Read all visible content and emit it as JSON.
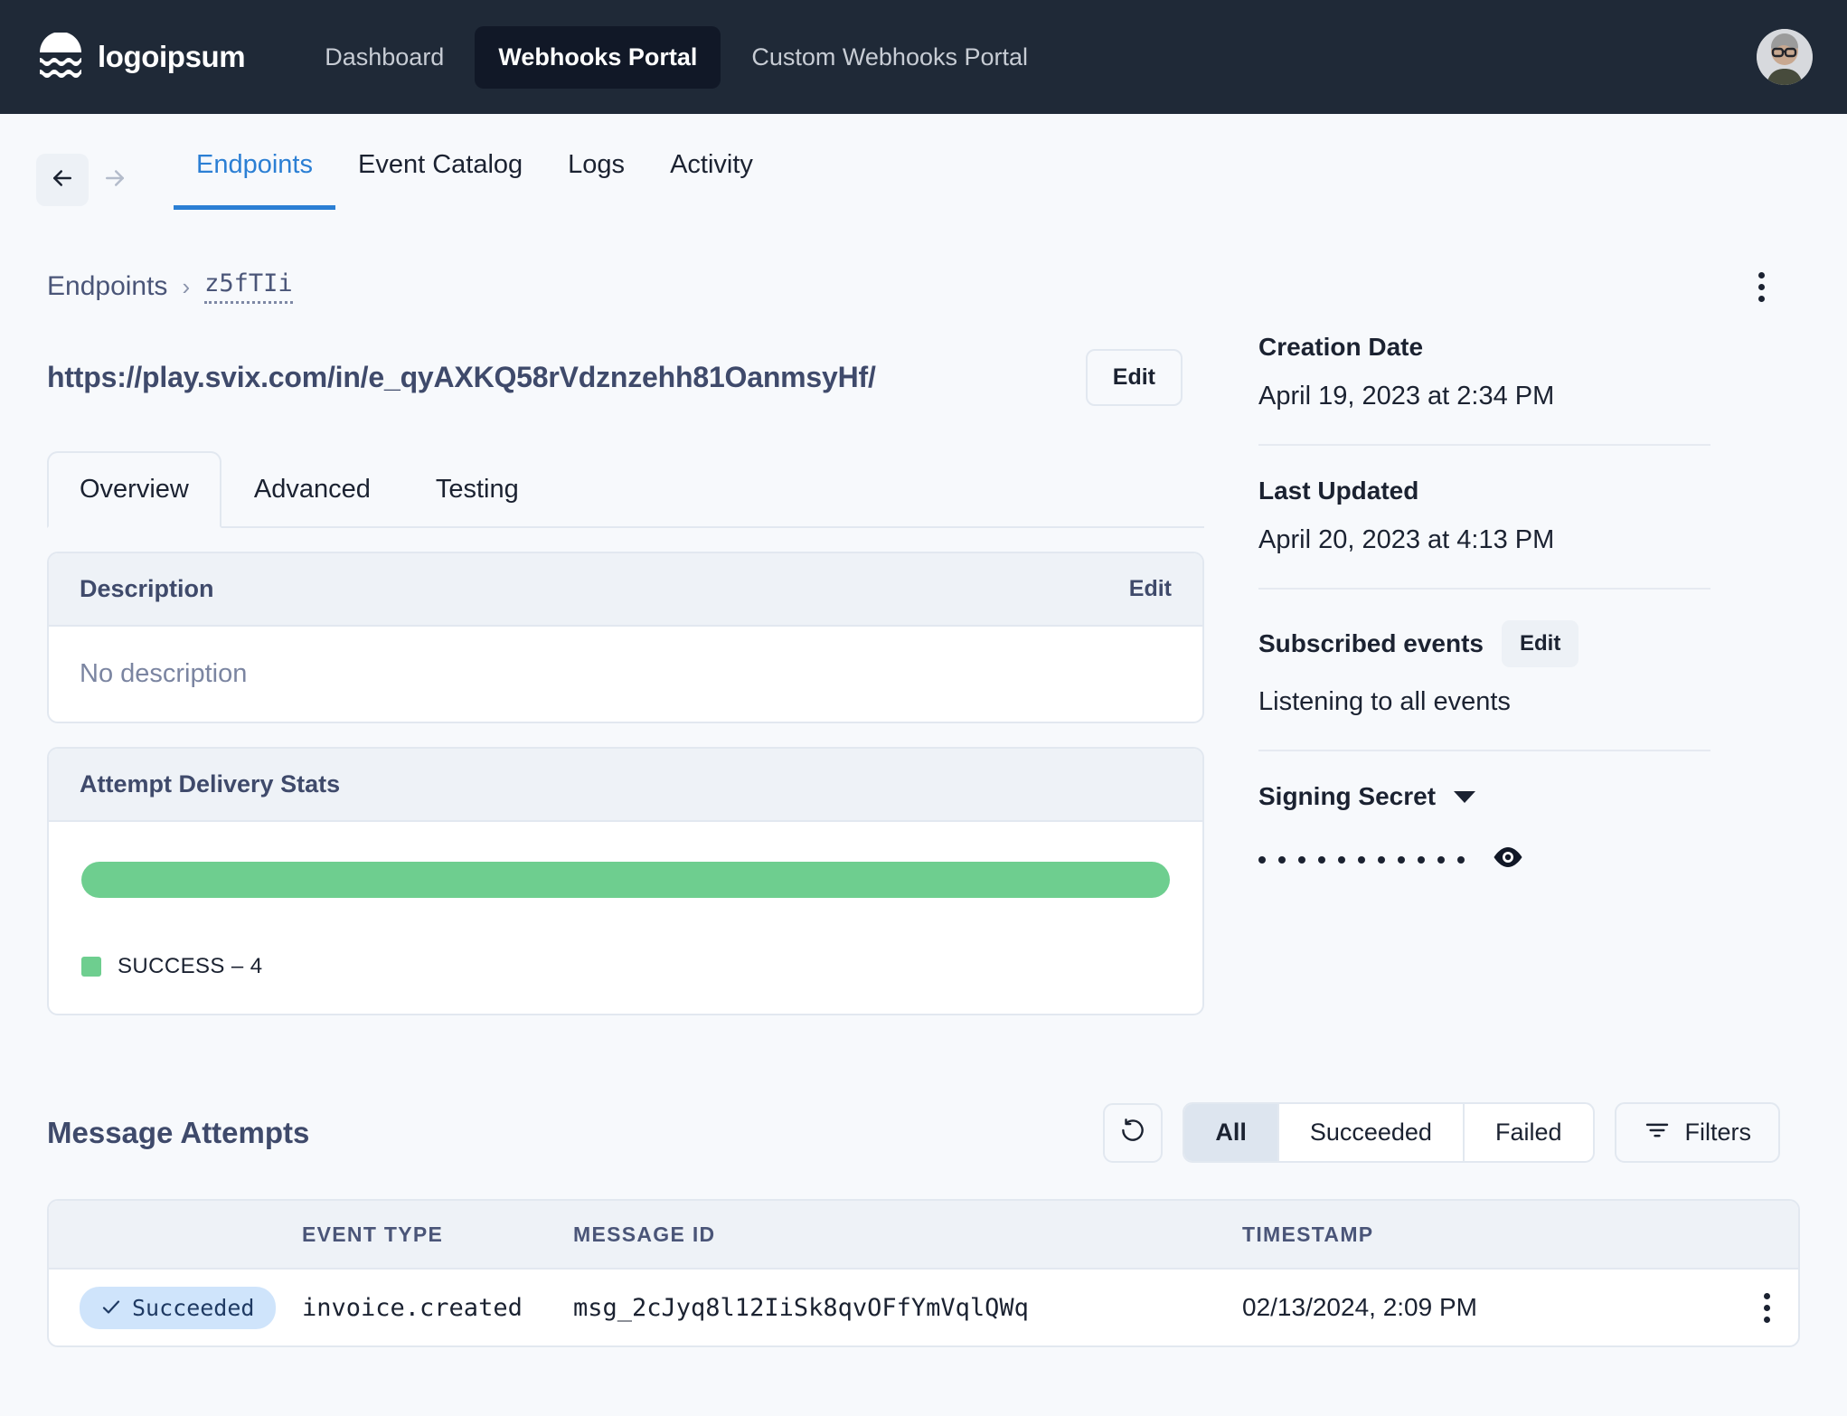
{
  "topnav": {
    "brand": "logoipsum",
    "brand_icon": "wave-logo-icon",
    "links": [
      {
        "label": "Dashboard",
        "active": false
      },
      {
        "label": "Webhooks Portal",
        "active": true
      },
      {
        "label": "Custom Webhooks Portal",
        "active": false
      }
    ],
    "avatar_name": "user-avatar"
  },
  "subnav": {
    "back_icon": "arrow-left-icon",
    "forward_icon": "arrow-right-icon",
    "tabs": [
      {
        "label": "Endpoints",
        "active": true
      },
      {
        "label": "Event Catalog",
        "active": false
      },
      {
        "label": "Logs",
        "active": false
      },
      {
        "label": "Activity",
        "active": false
      }
    ]
  },
  "breadcrumb": {
    "root": "Endpoints",
    "separator": "›",
    "current": "z5fTIi",
    "kebab_icon": "more-vertical-icon"
  },
  "endpoint": {
    "url": "https://play.svix.com/in/e_qyAXKQ58rVdznzehh81OanmsyHf/",
    "edit_label": "Edit",
    "tabs": [
      {
        "label": "Overview",
        "active": true
      },
      {
        "label": "Advanced",
        "active": false
      },
      {
        "label": "Testing",
        "active": false
      }
    ]
  },
  "description_panel": {
    "title": "Description",
    "edit_label": "Edit",
    "placeholder": "No description"
  },
  "stats_panel": {
    "title": "Attempt Delivery Stats"
  },
  "chart_data": {
    "type": "bar",
    "title": "Attempt Delivery Stats",
    "categories": [
      "SUCCESS"
    ],
    "values": [
      4
    ],
    "legend": [
      {
        "label": "SUCCESS – 4",
        "value": 4,
        "color": "#6ece8f",
        "percent": 100
      }
    ],
    "legend_position": "bottom-left",
    "grid": false,
    "orientation": "horizontal-stacked",
    "total": 4,
    "xlabel": "",
    "ylabel": ""
  },
  "sidebar": {
    "creation_date_label": "Creation Date",
    "creation_date_value": "April 19, 2023 at 2:34 PM",
    "last_updated_label": "Last Updated",
    "last_updated_value": "April 20, 2023 at 4:13 PM",
    "subscribed_events_label": "Subscribed events",
    "subscribed_events_edit": "Edit",
    "subscribed_events_value": "Listening to all events",
    "signing_secret_label": "Signing Secret",
    "signing_secret_caret": "chevron-down-icon",
    "signing_secret_masked_count": 11,
    "signing_secret_reveal_icon": "eye-icon"
  },
  "attempts": {
    "title": "Message Attempts",
    "refresh_icon": "refresh-icon",
    "segments": [
      {
        "label": "All",
        "active": true
      },
      {
        "label": "Succeeded",
        "active": false
      },
      {
        "label": "Failed",
        "active": false
      }
    ],
    "filters_label": "Filters",
    "filters_icon": "filter-icon",
    "columns": [
      "",
      "EVENT TYPE",
      "MESSAGE ID",
      "TIMESTAMP",
      ""
    ],
    "rows": [
      {
        "status": "Succeeded",
        "status_icon": "check-icon",
        "event_type": "invoice.created",
        "message_id": "msg_2cJyq8l12IiSk8qvOFfYmVqlQWq",
        "timestamp": "02/13/2024, 2:09 PM",
        "row_menu_icon": "more-vertical-icon"
      }
    ]
  },
  "colors": {
    "nav_bg": "#1f2937",
    "nav_active_bg": "#111827",
    "accent": "#2b7fd4",
    "success": "#6ece8f",
    "badge_bg": "#cfe4fb",
    "page_bg": "#f7f9fc",
    "panel_head_bg": "#eef2f7",
    "border": "#e2e8f0",
    "heading": "#3f4a6b"
  }
}
